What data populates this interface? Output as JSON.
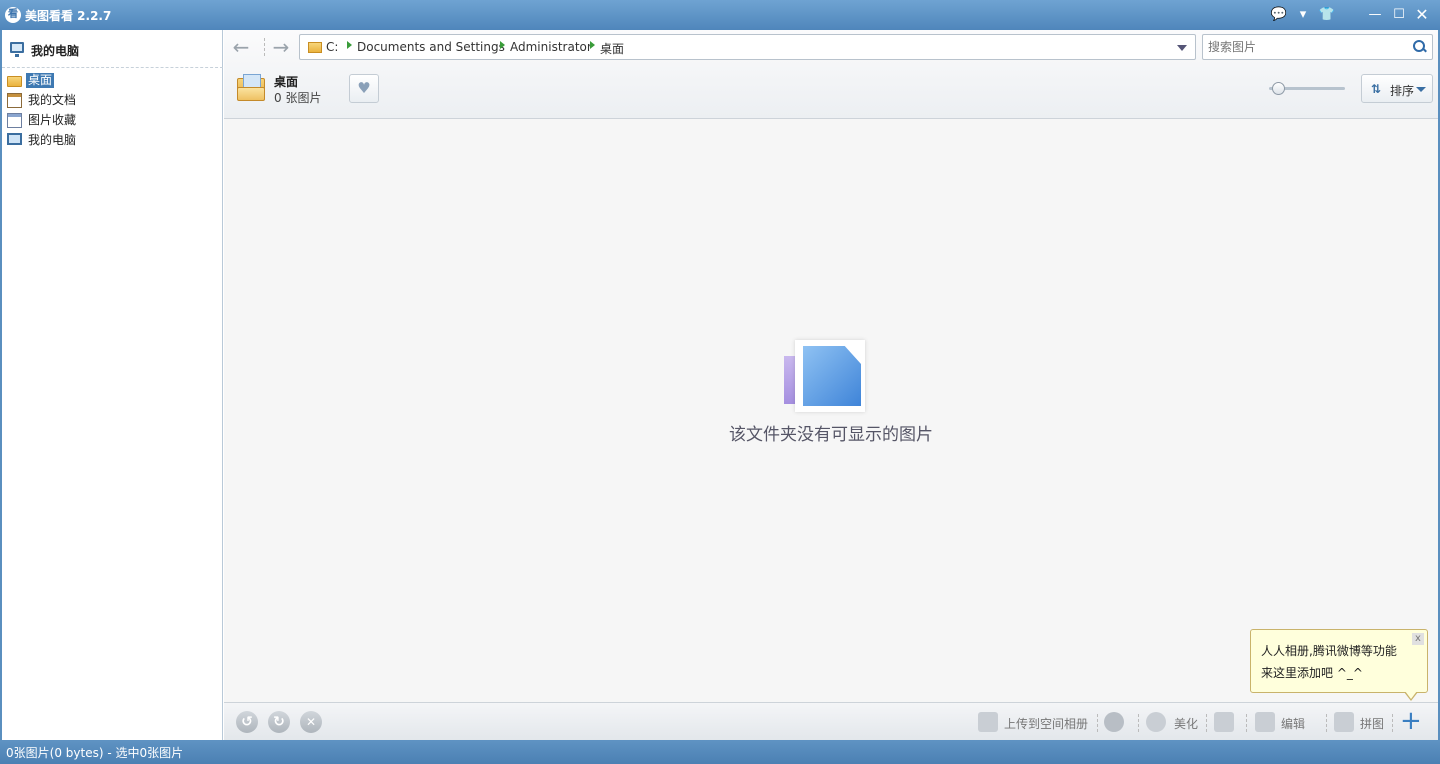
{
  "window": {
    "app_icon_text": "看",
    "title": "美图看看 2.2.7",
    "controls": {
      "feedback": "💬",
      "menu": "▾",
      "skin": "👕",
      "minimize": "—",
      "maximize": "☐",
      "close": "✕"
    }
  },
  "sidebar": {
    "header": "我的电脑",
    "items": [
      {
        "label": "桌面",
        "icon": "folder-icon",
        "selected": true
      },
      {
        "label": "我的文档",
        "icon": "documents-icon"
      },
      {
        "label": "图片收藏",
        "icon": "pictures-icon"
      },
      {
        "label": "我的电脑",
        "icon": "computer-icon"
      }
    ]
  },
  "nav": {
    "back": "←",
    "forward": "→"
  },
  "address": {
    "crumbs": [
      "C:",
      "Documents and Settings",
      "Administrator",
      "桌面"
    ]
  },
  "search": {
    "placeholder": "搜索图片"
  },
  "folder": {
    "name": "桌面",
    "count": "0 张图片",
    "favorite_icon": "♥"
  },
  "zoom_level": 0.05,
  "sort": {
    "icon": "⇅",
    "label": "排序"
  },
  "empty": {
    "message": "该文件夹没有可显示的图片"
  },
  "tooltip": {
    "line1": "人人相册,腾讯微博等功能",
    "line2": "来这里添加吧 ^_^",
    "close": "x"
  },
  "bottom": {
    "rotate_left": "↺",
    "rotate_right": "↻",
    "delete": "✕",
    "upload": "上传到空间相册",
    "beautify": "美化",
    "edit": "编辑",
    "collage": "拼图",
    "add": "+"
  },
  "status": {
    "text": "0张图片(0 bytes) - 选中0张图片"
  }
}
